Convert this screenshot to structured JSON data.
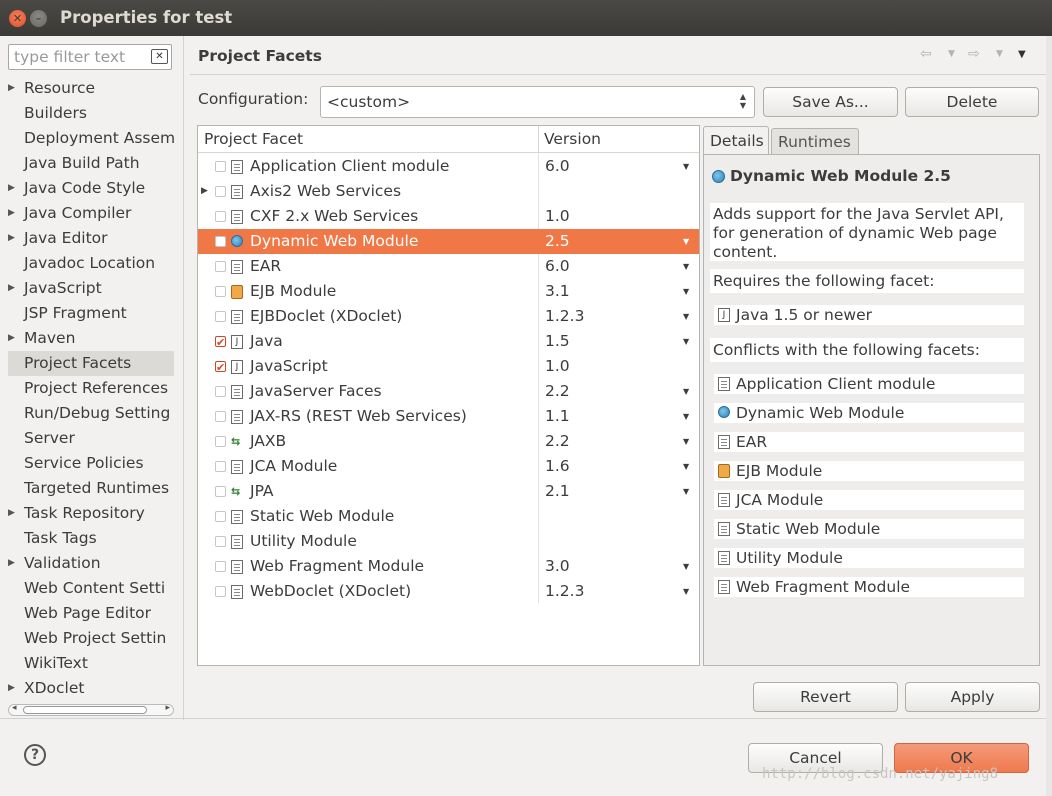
{
  "window": {
    "title": "Properties for test"
  },
  "filter": {
    "placeholder": "type filter text"
  },
  "tree": {
    "items": [
      {
        "label": "Resource",
        "expandable": true
      },
      {
        "label": "Builders",
        "expandable": false
      },
      {
        "label": "Deployment Assem",
        "expandable": false
      },
      {
        "label": "Java Build Path",
        "expandable": false
      },
      {
        "label": "Java Code Style",
        "expandable": true
      },
      {
        "label": "Java Compiler",
        "expandable": true
      },
      {
        "label": "Java Editor",
        "expandable": true
      },
      {
        "label": "Javadoc Location",
        "expandable": false
      },
      {
        "label": "JavaScript",
        "expandable": true
      },
      {
        "label": "JSP Fragment",
        "expandable": false
      },
      {
        "label": "Maven",
        "expandable": true
      },
      {
        "label": "Project Facets",
        "expandable": false,
        "selected": true
      },
      {
        "label": "Project References",
        "expandable": false
      },
      {
        "label": "Run/Debug Setting",
        "expandable": false
      },
      {
        "label": "Server",
        "expandable": false
      },
      {
        "label": "Service Policies",
        "expandable": false
      },
      {
        "label": "Targeted Runtimes",
        "expandable": false
      },
      {
        "label": "Task Repository",
        "expandable": true
      },
      {
        "label": "Task Tags",
        "expandable": false
      },
      {
        "label": "Validation",
        "expandable": true
      },
      {
        "label": "Web Content Setti",
        "expandable": false
      },
      {
        "label": "Web Page Editor",
        "expandable": false
      },
      {
        "label": "Web Project Settin",
        "expandable": false
      },
      {
        "label": "WikiText",
        "expandable": false
      },
      {
        "label": "XDoclet",
        "expandable": true
      }
    ]
  },
  "page": {
    "title": "Project Facets"
  },
  "configuration": {
    "label": "Configuration:",
    "value": "<custom>",
    "save_as": "Save As...",
    "delete": "Delete"
  },
  "facets": {
    "col_facet": "Project Facet",
    "col_version": "Version",
    "rows": [
      {
        "name": "Application Client module",
        "version": "6.0",
        "checked": false,
        "icon": "document-icon",
        "dropdown": true
      },
      {
        "name": "Axis2 Web Services",
        "version": "",
        "checked": false,
        "icon": "document-icon",
        "dropdown": false,
        "expandable": true
      },
      {
        "name": "CXF 2.x Web Services",
        "version": "1.0",
        "checked": false,
        "icon": "document-icon",
        "dropdown": false
      },
      {
        "name": "Dynamic Web Module",
        "version": "2.5",
        "checked": false,
        "icon": "globe-icon",
        "dropdown": true,
        "selected": true
      },
      {
        "name": "EAR",
        "version": "6.0",
        "checked": false,
        "icon": "document-icon",
        "dropdown": true
      },
      {
        "name": "EJB Module",
        "version": "3.1",
        "checked": false,
        "icon": "bean-icon",
        "dropdown": true
      },
      {
        "name": "EJBDoclet (XDoclet)",
        "version": "1.2.3",
        "checked": false,
        "icon": "document-icon",
        "dropdown": true
      },
      {
        "name": "Java",
        "version": "1.5",
        "checked": true,
        "icon": "java-icon",
        "dropdown": true
      },
      {
        "name": "JavaScript",
        "version": "1.0",
        "checked": true,
        "icon": "javascript-icon",
        "dropdown": false
      },
      {
        "name": "JavaServer Faces",
        "version": "2.2",
        "checked": false,
        "icon": "document-icon",
        "dropdown": true
      },
      {
        "name": "JAX-RS (REST Web Services)",
        "version": "1.1",
        "checked": false,
        "icon": "document-icon",
        "dropdown": true
      },
      {
        "name": "JAXB",
        "version": "2.2",
        "checked": false,
        "icon": "arrows-icon",
        "dropdown": true
      },
      {
        "name": "JCA Module",
        "version": "1.6",
        "checked": false,
        "icon": "document-icon",
        "dropdown": true
      },
      {
        "name": "JPA",
        "version": "2.1",
        "checked": false,
        "icon": "arrows-icon",
        "dropdown": true
      },
      {
        "name": "Static Web Module",
        "version": "",
        "checked": false,
        "icon": "document-icon",
        "dropdown": false
      },
      {
        "name": "Utility Module",
        "version": "",
        "checked": false,
        "icon": "document-icon",
        "dropdown": false
      },
      {
        "name": "Web Fragment Module",
        "version": "3.0",
        "checked": false,
        "icon": "document-icon",
        "dropdown": true
      },
      {
        "name": "WebDoclet (XDoclet)",
        "version": "1.2.3",
        "checked": false,
        "icon": "document-icon",
        "dropdown": true
      }
    ]
  },
  "details": {
    "tab_details": "Details",
    "tab_runtimes": "Runtimes",
    "title": "Dynamic Web Module 2.5",
    "description": "Adds support for the Java Servlet API, for generation of dynamic Web page content.",
    "requires_label": "Requires the following facet:",
    "requires": [
      {
        "name": "Java 1.5 or newer",
        "icon": "java-icon"
      }
    ],
    "conflicts_label": "Conflicts with the following facets:",
    "conflicts": [
      {
        "name": "Application Client module",
        "icon": "document-icon"
      },
      {
        "name": "Dynamic Web Module",
        "icon": "globe-icon"
      },
      {
        "name": "EAR",
        "icon": "document-icon"
      },
      {
        "name": "EJB Module",
        "icon": "bean-icon"
      },
      {
        "name": "JCA Module",
        "icon": "document-icon"
      },
      {
        "name": "Static Web Module",
        "icon": "document-icon"
      },
      {
        "name": "Utility Module",
        "icon": "document-icon"
      },
      {
        "name": "Web Fragment Module",
        "icon": "document-icon"
      }
    ]
  },
  "buttons": {
    "revert": "Revert",
    "apply": "Apply",
    "cancel": "Cancel",
    "ok": "OK"
  },
  "watermark": "http://blog.csdn.net/yajing8",
  "colors": {
    "selection": "#f07746",
    "ok_button": "#ef7a4f",
    "titlebar": "#3c3b37"
  }
}
